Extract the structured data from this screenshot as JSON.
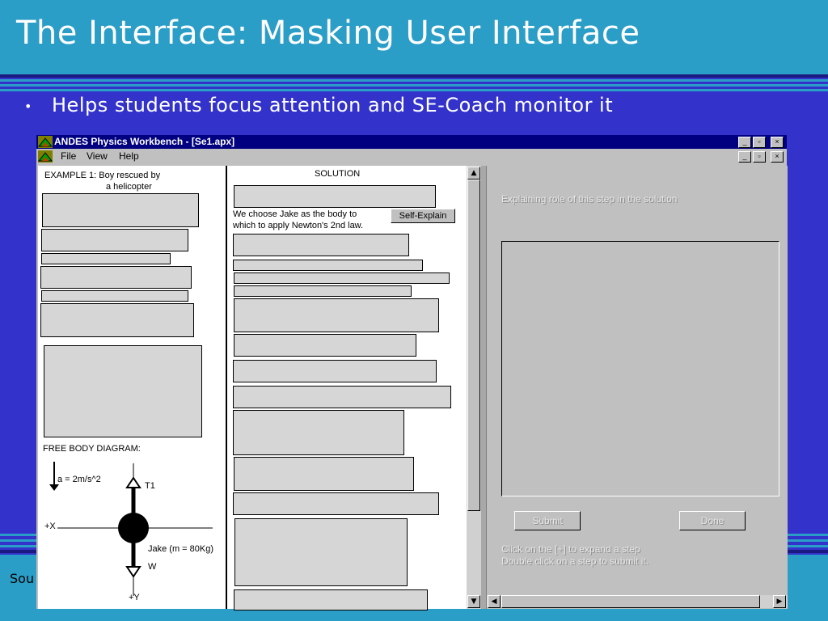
{
  "slide": {
    "title": "The Interface: Masking User Interface",
    "bullet": "Helps students focus attention and SE-Coach monitor it",
    "bullet_marker": "•",
    "footer_text": "Sou"
  },
  "window": {
    "title": "ANDES Physics Workbench - [Se1.apx]",
    "controls": [
      "_",
      "▫",
      "×"
    ],
    "menu": [
      "File",
      "View",
      "Help"
    ]
  },
  "left_panel": {
    "example_line1": "EXAMPLE 1: Boy rescued by",
    "example_line2": "a helicopter",
    "fbd_label": "FREE BODY DIAGRAM:",
    "accel_label": "a = 2m/s^2",
    "tension_label": "T1",
    "x_label": "+X",
    "mass_label": "Jake (m = 80Kg)",
    "weight_label": "W",
    "y_label": "+Y"
  },
  "middle_panel": {
    "heading": "SOLUTION",
    "step_line1": "We choose Jake as the body to",
    "step_line2": "which to apply Newton's 2nd law.",
    "self_explain_label": "Self-Explain"
  },
  "right_panel": {
    "prompt": "Explaining role of this step in the solution",
    "submit_label": "Submit",
    "done_label": "Done",
    "hint_line1": "Click on the [+] to expand a step",
    "hint_line2": "Double click on a step to submit it."
  },
  "colors": {
    "slide_background": "#3333cc",
    "slide_header": "#2b9ec8",
    "window_titlebar": "#000080"
  },
  "icons": [
    "andes-app-icon",
    "andes-doc-icon",
    "minimize-icon",
    "restore-icon",
    "close-icon",
    "scroll-up-icon",
    "scroll-down-icon",
    "scroll-left-icon",
    "scroll-right-icon"
  ]
}
